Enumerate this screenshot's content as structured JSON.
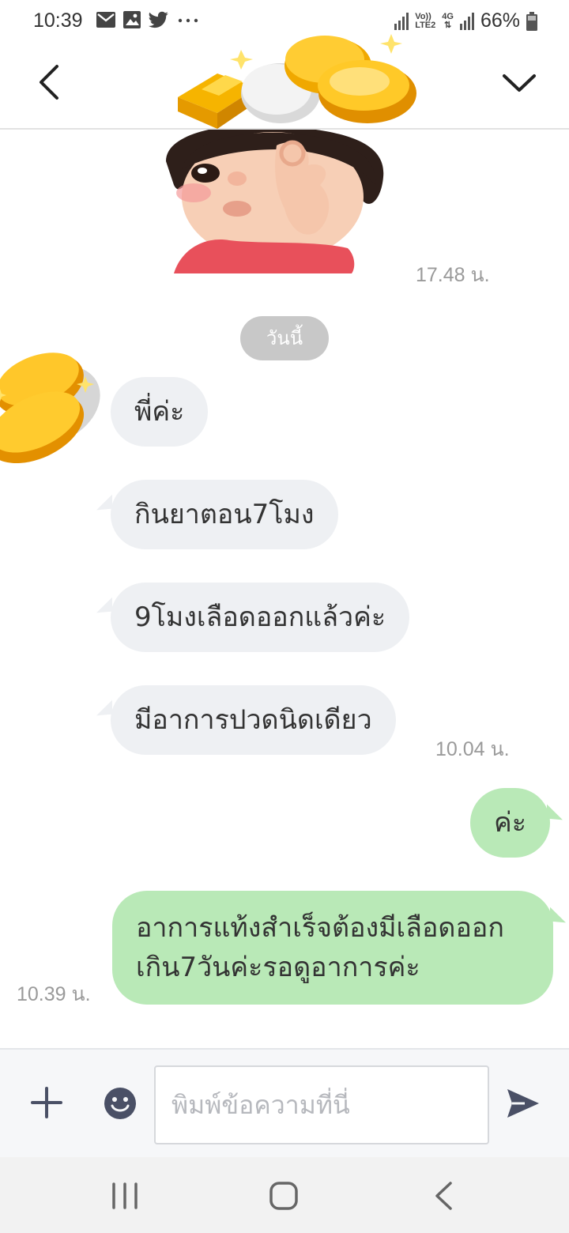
{
  "status_bar": {
    "time": "10:39",
    "network_label_top": "Vo))",
    "network_label_bottom": "LTE2",
    "network_gen": "4G",
    "battery": "66%"
  },
  "header": {
    "back_icon": "chevron-left-icon",
    "collapse_icon": "chevron-down-icon"
  },
  "chat": {
    "first_sticker_time": "17.48 น.",
    "date_separator": "วันนี้",
    "incoming": [
      {
        "text": "พี่ค่ะ"
      },
      {
        "text": "กินยาตอน7โมง"
      },
      {
        "text": "9โมงเลือดออกแล้วค่ะ"
      },
      {
        "text": "มีอาการปวดนิดเดียว"
      }
    ],
    "incoming_time": "10.04 น.",
    "outgoing": [
      {
        "text": "ค่ะ"
      },
      {
        "text": "อาการแท้งสำเร็จต้องมีเลือดออกเกิน7วันค่ะรอดูอาการค่ะ"
      }
    ],
    "outgoing_time": "10.39 น."
  },
  "input_bar": {
    "placeholder": "พิมพ์ข้อความที่นี่",
    "plus_icon": "plus-icon",
    "emoji_icon": "emoji-icon",
    "send_icon": "send-icon"
  },
  "colors": {
    "incoming_bubble": "#eef0f3",
    "outgoing_bubble": "#b9e9b7",
    "time_text": "#9a9a9a",
    "date_pill": "#c8c8c8"
  }
}
